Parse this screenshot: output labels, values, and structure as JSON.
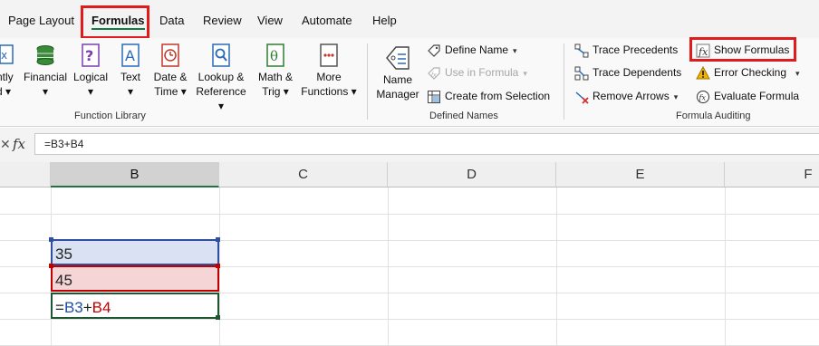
{
  "tabs": [
    {
      "label": "Page Layout"
    },
    {
      "label": "Formulas",
      "active": true
    },
    {
      "label": "Data"
    },
    {
      "label": "Review"
    },
    {
      "label": "View"
    },
    {
      "label": "Automate"
    },
    {
      "label": "Help"
    }
  ],
  "ribbon": {
    "function_library": {
      "partial_label_1": "ntly",
      "partial_label_2": "d ▾",
      "buttons": [
        {
          "label1": "Financial",
          "label2": "▾",
          "icon": "financial-icon"
        },
        {
          "label1": "Logical",
          "label2": "▾",
          "icon": "logical-icon"
        },
        {
          "label1": "Text",
          "label2": "▾",
          "icon": "text-icon"
        },
        {
          "label1": "Date &",
          "label2": "Time ▾",
          "icon": "date-time-icon"
        },
        {
          "label1": "Lookup &",
          "label2": "Reference ▾",
          "icon": "lookup-icon"
        },
        {
          "label1": "Math &",
          "label2": "Trig ▾",
          "icon": "math-icon"
        },
        {
          "label1": "More",
          "label2": "Functions ▾",
          "icon": "more-functions-icon"
        }
      ],
      "group_label": "Function Library"
    },
    "defined_names": {
      "name_manager": {
        "label1": "Name",
        "label2": "Manager"
      },
      "define_name": "Define Name",
      "use_in_formula": "Use in Formula",
      "create_from_selection": "Create from Selection",
      "group_label": "Defined Names"
    },
    "formula_auditing": {
      "trace_precedents": "Trace Precedents",
      "trace_dependents": "Trace Dependents",
      "remove_arrows": "Remove Arrows",
      "show_formulas": "Show Formulas",
      "error_checking": "Error Checking",
      "evaluate_formula": "Evaluate Formula",
      "group_label": "Formula Auditing"
    }
  },
  "formula_bar": {
    "fx_label": "fx",
    "content": "=B3+B4"
  },
  "columns": [
    "B",
    "C",
    "D",
    "E",
    "F"
  ],
  "cells": {
    "b3": "35",
    "b4": "45",
    "b5_eq": "=",
    "b5_ref1": "B3",
    "b5_op": "+",
    "b5_ref2": "B4"
  },
  "colors": {
    "accent": "#107c41",
    "highlight_box": "#e01b1b",
    "ref_blue": "#1f4ea3",
    "ref_red": "#c00000",
    "b3_fill": "#d9e1f2",
    "b4_fill": "#f5d5d5"
  }
}
